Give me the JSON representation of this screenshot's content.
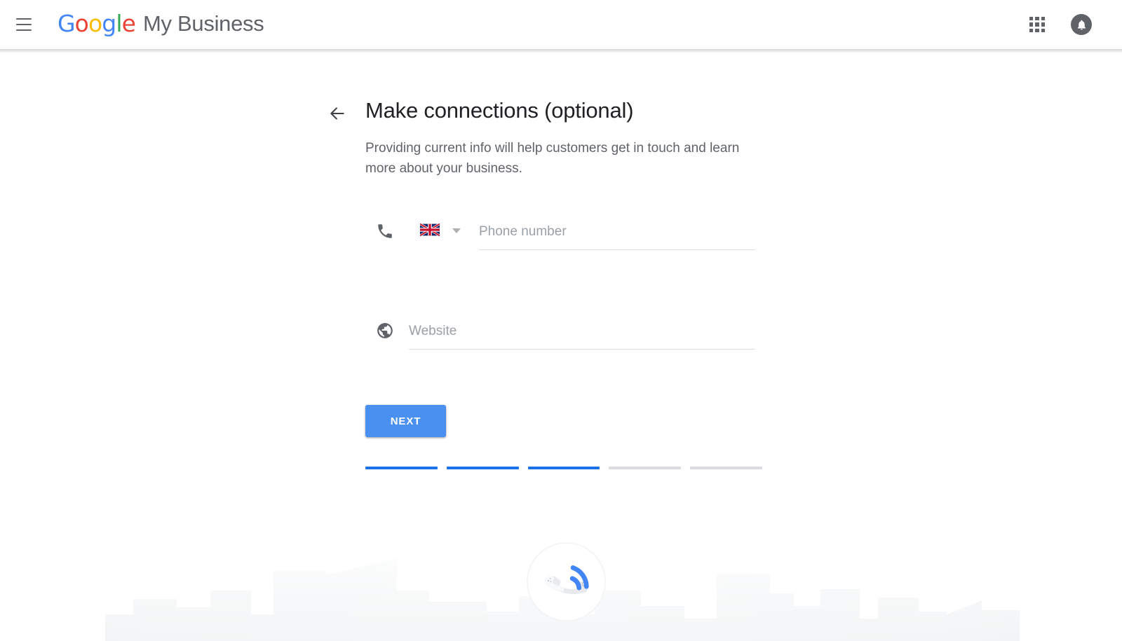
{
  "header": {
    "menu_label": "Main menu",
    "menu_icon": "hamburger-menu-icon",
    "logo": {
      "google_letters": [
        {
          "char": "G",
          "color": "#4285F4"
        },
        {
          "char": "o",
          "color": "#EA4335"
        },
        {
          "char": "o",
          "color": "#FBBC05"
        },
        {
          "char": "g",
          "color": "#4285F4"
        },
        {
          "char": "l",
          "color": "#34A853"
        },
        {
          "char": "e",
          "color": "#EA4335"
        }
      ],
      "product_name": "My Business"
    },
    "apps_icon": "apps-grid-icon",
    "notifications_icon": "notification-bell-icon"
  },
  "main": {
    "back_icon": "back-arrow-icon",
    "title": "Make connections (optional)",
    "subtitle": "Providing current info will help customers get in touch and learn more about your business.",
    "phone_field": {
      "icon": "phone-icon",
      "country_flag": "united-kingdom-flag-icon",
      "country_code": "GB",
      "dropdown_icon": "chevron-down-icon",
      "placeholder": "Phone number",
      "value": ""
    },
    "website_field": {
      "icon": "globe-icon",
      "placeholder": "Website",
      "value": ""
    },
    "next_label": "NEXT",
    "next_color": "#4a90f0",
    "progress": {
      "total_steps": 5,
      "completed_steps": 3,
      "active_color": "#1a73e8",
      "inactive_color": "#dadce0"
    }
  },
  "illustration": {
    "name": "ringing-phone-illustration",
    "background": "cityscape-silhouette",
    "handset_color": "#e8eaed",
    "signal_color": "#4285F4",
    "circle_color": "#ffffff"
  }
}
